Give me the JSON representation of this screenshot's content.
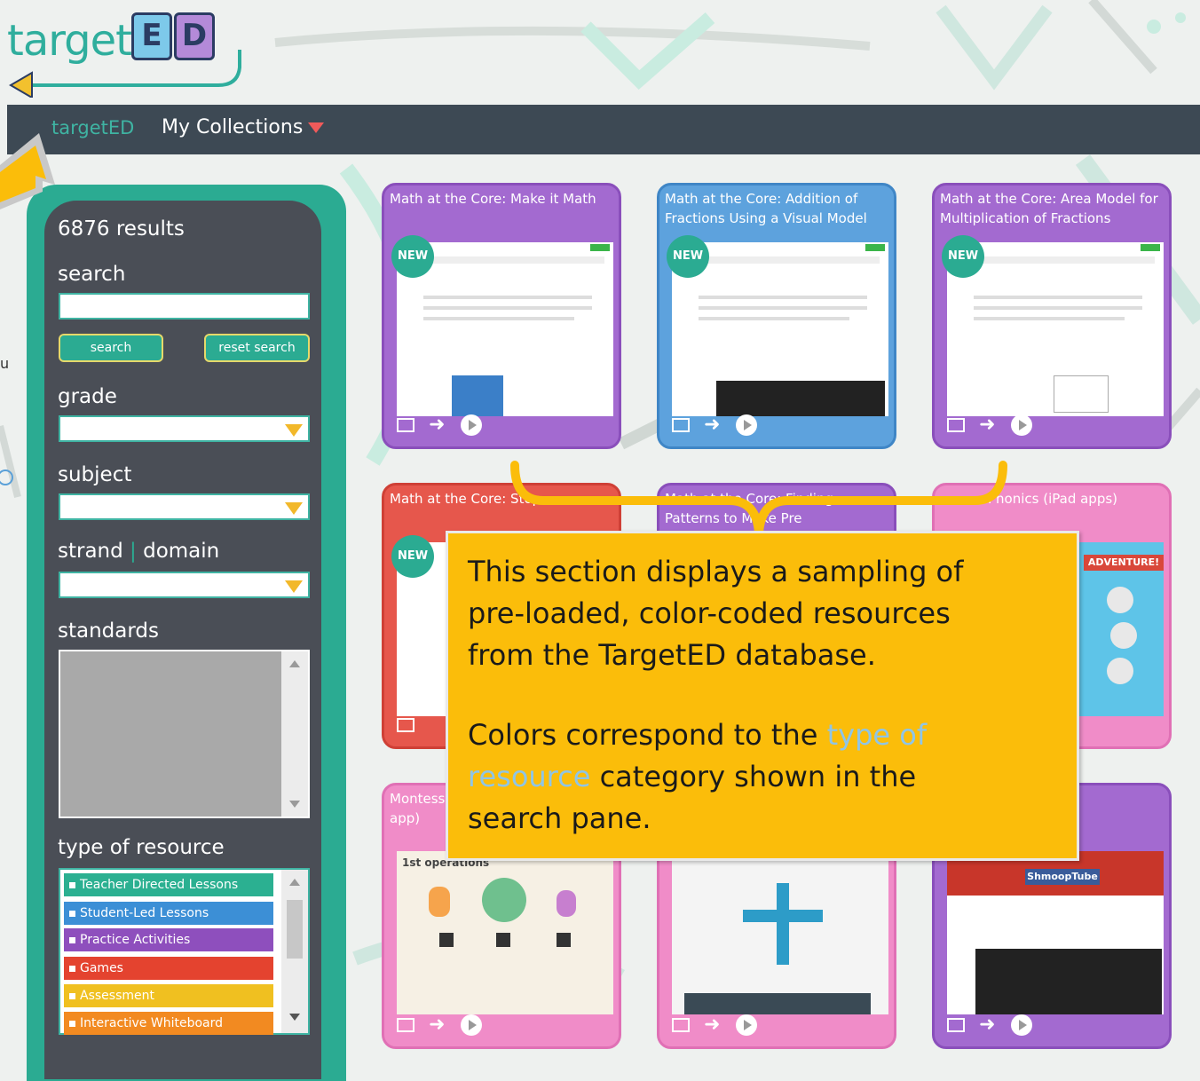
{
  "header": {
    "logo_text": "target",
    "logo_letters": [
      "E",
      "D"
    ]
  },
  "nav": {
    "brand": "targetED",
    "collections": "My Collections"
  },
  "sidebar": {
    "results": "6876 results",
    "search_label": "search",
    "search_value": "",
    "search_button": "search",
    "reset_button": "reset search",
    "grade_label": "grade",
    "subject_label": "subject",
    "strand_label": "strand",
    "domain_label": "domain",
    "standards_label": "standards",
    "type_label": "type of resource",
    "types": [
      {
        "label": "Teacher Directed Lessons",
        "color": "#2bb091"
      },
      {
        "label": "Student-Led Lessons",
        "color": "#3c8fd6"
      },
      {
        "label": "Practice Activities",
        "color": "#8e4fbd"
      },
      {
        "label": "Games",
        "color": "#e4432f"
      },
      {
        "label": "Assessment",
        "color": "#f0c020"
      },
      {
        "label": "Interactive Whiteboard",
        "color": "#f28a21"
      }
    ]
  },
  "cards": [
    {
      "title": "Math at the Core: Make it Math",
      "new_label": "NEW",
      "color": "#a36ad0"
    },
    {
      "title": "Math at the Core: Addition of Fractions Using a Visual Model",
      "new_label": "NEW",
      "color": "#5da2dd"
    },
    {
      "title": "Math at the Core: Area Model for Multiplication of Fractions",
      "new_label": "NEW",
      "color": "#a36ad0"
    },
    {
      "title": "Math at the Core: Stop",
      "new_label": "NEW",
      "color": "#e6574c"
    },
    {
      "title": "Math at the Core: Finding Patterns to Make Pre",
      "color": "#a36ad0"
    },
    {
      "title": "Phonics (iPad apps)",
      "color": "#f08cc8",
      "thumb_text": "ADVENTURE!"
    },
    {
      "title": "Montess",
      "title2": "app)",
      "color": "#f08cc8",
      "thumb_text": "1st operations"
    },
    {
      "title": "",
      "color": "#f08cc8",
      "thumb_text": ""
    },
    {
      "title": "",
      "color": "#a36ad0",
      "thumb_text": "ShmoopTube"
    }
  ],
  "callout": {
    "line1": "This section displays a sampling of",
    "line2": "pre-loaded, color-coded resources",
    "line3": "from the TargetED database.",
    "line4a": "Colors correspond to the ",
    "line4b": "type of",
    "line5a": "resource",
    "line5b": " category shown in the",
    "line6": "search pane."
  }
}
